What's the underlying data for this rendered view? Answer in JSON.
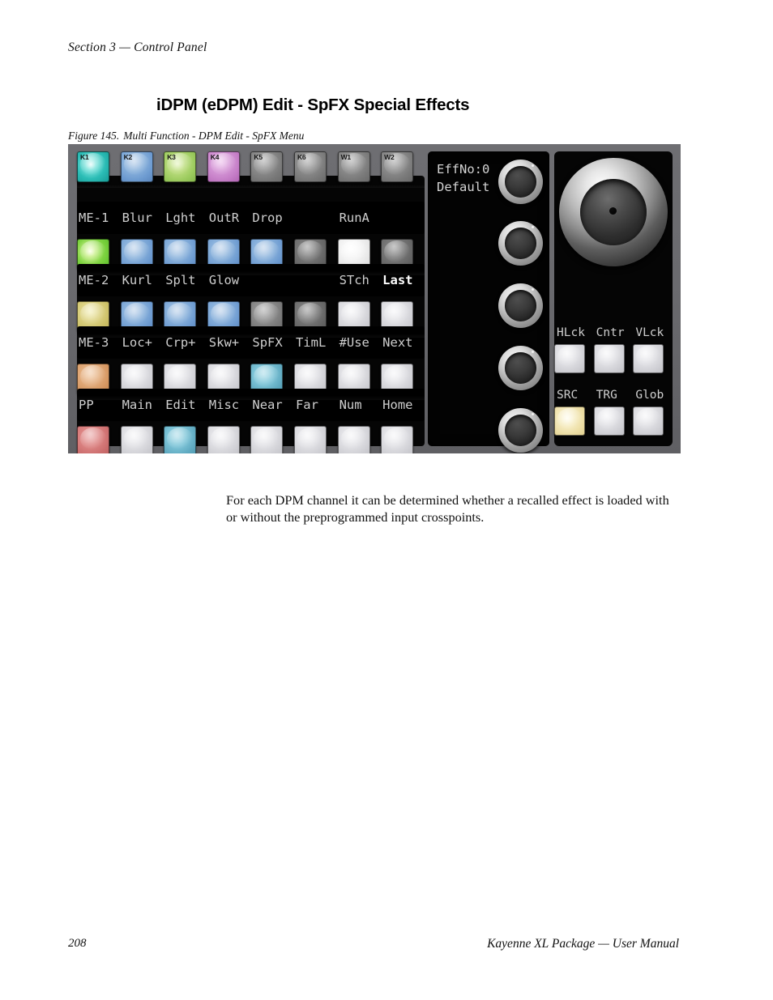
{
  "page": {
    "running_head": "Section 3 — Control Panel",
    "chapter_title": "iDPM (eDPM) Edit - SpFX Special Effects",
    "figure_number": "Figure 145.",
    "figure_caption": "Multi Function - DPM Edit - SpFX Menu",
    "body_text": "For each DPM channel it can be determined whether a recalled effect is loaded with or without the preprogrammed input crosspoints.",
    "folio_page": "208",
    "folio_book": "Kayenne XL Package  —  User Manual"
  },
  "panel": {
    "button_rows": [
      {
        "keys": [
          "K1",
          "K2",
          "K3",
          "K4",
          "K5",
          "K6",
          "W1",
          "W2"
        ],
        "colors": [
          "cyanlit",
          "blue",
          "green",
          "magenta",
          "gray",
          "gray",
          "gray",
          "gray"
        ]
      },
      {
        "keys": [
          "",
          "",
          "",
          "",
          "",
          "",
          "",
          ""
        ],
        "colors": [
          "greenlit",
          "blue",
          "blue",
          "blue",
          "blue",
          "grayd",
          "whitehot",
          "grayd"
        ]
      },
      {
        "keys": [
          "",
          "",
          "",
          "",
          "",
          "",
          "",
          ""
        ],
        "colors": [
          "yellow",
          "blue",
          "blue",
          "blue",
          "gray",
          "grayd",
          "white",
          "white"
        ]
      },
      {
        "keys": [
          "",
          "",
          "",
          "",
          "",
          "",
          "",
          ""
        ],
        "colors": [
          "orange",
          "white",
          "white",
          "white",
          "teal",
          "white",
          "white",
          "white"
        ]
      },
      {
        "keys": [
          "",
          "",
          "",
          "",
          "",
          "",
          "",
          ""
        ],
        "colors": [
          "red",
          "white",
          "teal",
          "white",
          "white",
          "white",
          "white",
          "white"
        ]
      }
    ],
    "label_rows": [
      {
        "labels": [
          "ME-1",
          "Blur",
          "Lght",
          "OutR",
          "Drop",
          "",
          "RunA",
          ""
        ],
        "bold": []
      },
      {
        "labels": [
          "ME-2",
          "Kurl",
          "Splt",
          "Glow",
          "",
          "",
          "STch",
          "Last"
        ],
        "bold": [
          7
        ]
      },
      {
        "labels": [
          "ME-3",
          "Loc+",
          "Crp+",
          "Skw+",
          "SpFX",
          "TimL",
          "#Use",
          "Next"
        ],
        "bold": []
      },
      {
        "labels": [
          "PP",
          "Main",
          "Edit",
          "Misc",
          "Near",
          "Far",
          "Num",
          "Home"
        ],
        "bold": []
      }
    ],
    "readout": {
      "line1": "EffNo:0",
      "line2": "Default"
    },
    "knobs": [
      "knob-1",
      "knob-2",
      "knob-3",
      "knob-4",
      "knob-5"
    ],
    "joystick_label": "joystick",
    "right_labels_top": [
      "HLck",
      "Cntr",
      "VLck"
    ],
    "right_colors_top": [
      "white",
      "white",
      "white"
    ],
    "right_labels_bottom": [
      "SRC",
      "TRG",
      "Glob"
    ],
    "right_colors_bottom": [
      "cream",
      "white",
      "white"
    ]
  },
  "colors": {
    "panel_body": "#6a6a6e",
    "lcd_black": "#000000",
    "lcd_text": "#cfcfcf",
    "lcd_text_active": "#ffffff",
    "lamp_cyan": "#2bbdb6",
    "lamp_blue": "#6c9ad0",
    "lamp_green": "#9ccb5e",
    "lamp_magenta": "#c47cc6",
    "lamp_yellow": "#cbbf65",
    "lamp_orange": "#d4955f",
    "lamp_teal": "#5fa9c0",
    "lamp_red": "#cb6d6d",
    "lamp_cream": "#ecdda3",
    "lamp_white": "#cfcfd4",
    "lamp_gray": "#787878"
  }
}
